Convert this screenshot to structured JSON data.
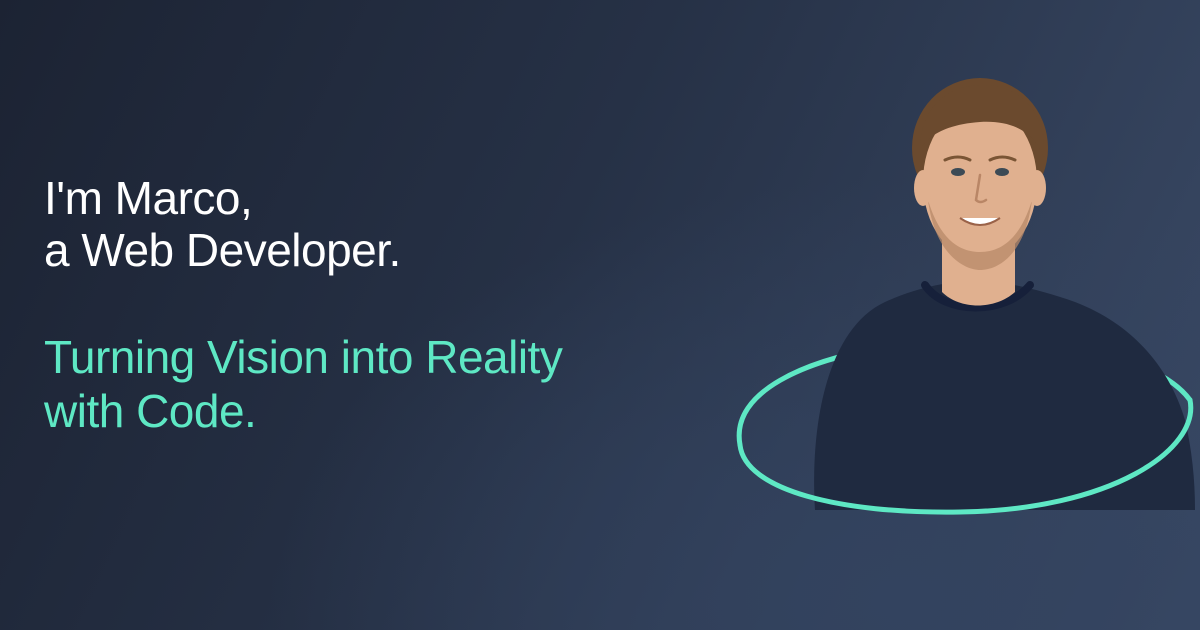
{
  "intro": {
    "line1": "I'm Marco,",
    "line2": "a Web Developer."
  },
  "tagline": {
    "line1": "Turning Vision into Reality",
    "line2": "with Code."
  },
  "colors": {
    "accent": "#5ee8c4",
    "text": "#ffffff",
    "background_dark": "#1c2333",
    "background_light": "#3a4a66",
    "shirt": "#1f2a40",
    "skin": "#e0b08f",
    "hair": "#6b4a2e"
  }
}
